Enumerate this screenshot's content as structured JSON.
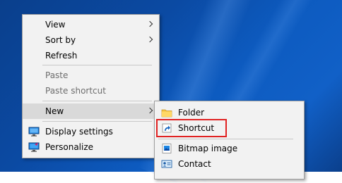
{
  "context_menu": {
    "items": [
      {
        "label": "View",
        "has_submenu": true,
        "enabled": true
      },
      {
        "label": "Sort by",
        "has_submenu": true,
        "enabled": true
      },
      {
        "label": "Refresh",
        "enabled": true
      },
      {
        "label": "Paste",
        "enabled": false
      },
      {
        "label": "Paste shortcut",
        "enabled": false
      },
      {
        "label": "New",
        "has_submenu": true,
        "enabled": true,
        "active": true
      },
      {
        "label": "Display settings",
        "icon": "display-settings-icon",
        "enabled": true
      },
      {
        "label": "Personalize",
        "icon": "personalize-icon",
        "enabled": true
      }
    ]
  },
  "new_submenu": {
    "items": [
      {
        "label": "Folder",
        "icon": "folder-icon"
      },
      {
        "label": "Shortcut",
        "icon": "shortcut-icon",
        "highlighted": true
      },
      {
        "label": "Bitmap image",
        "icon": "bitmap-image-icon"
      },
      {
        "label": "Contact",
        "icon": "contact-icon"
      }
    ]
  },
  "colors": {
    "highlight_border": "#e02222",
    "active_item_bg": "#d9d9d9",
    "menu_bg": "#f2f2f2"
  }
}
